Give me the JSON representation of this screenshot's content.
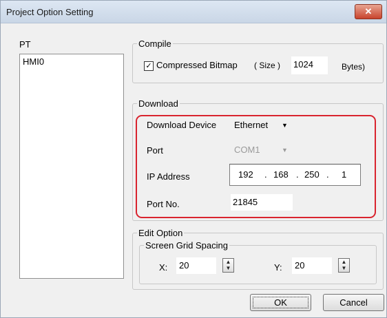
{
  "window": {
    "title": "Project Option Setting",
    "close_glyph": "✕"
  },
  "pt": {
    "label": "PT",
    "items": [
      "HMI0"
    ]
  },
  "compile": {
    "legend": "Compile",
    "checkbox_checked": true,
    "checkbox_label": "Compressed Bitmap",
    "size_label": "( Size )",
    "size_value": "1024",
    "bytes_label": "Bytes)"
  },
  "download": {
    "legend": "Download",
    "device_label": "Download Device",
    "device_value": "Ethernet",
    "port_label": "Port",
    "port_value": "COM1",
    "ip_label": "IP Address",
    "ip": [
      "192",
      "168",
      "250",
      "1"
    ],
    "ip_dot": ".",
    "portno_label": "Port No.",
    "portno_value": "21845"
  },
  "edit_option": {
    "legend": "Edit Option",
    "grid_legend": "Screen Grid Spacing",
    "x_label": "X:",
    "x_value": "20",
    "y_label": "Y:",
    "y_value": "20"
  },
  "buttons": {
    "ok": "OK",
    "cancel": "Cancel"
  },
  "highlight_color": "#d9232e"
}
